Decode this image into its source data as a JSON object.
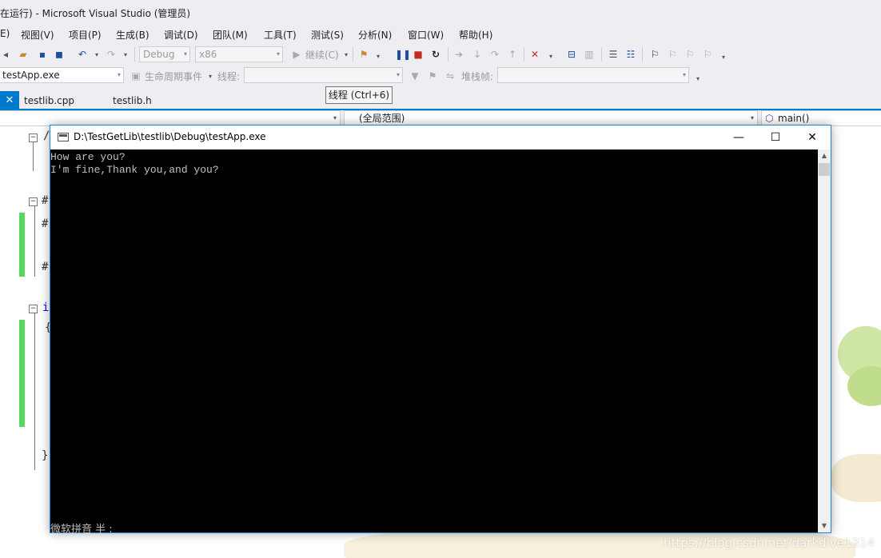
{
  "window": {
    "title": "在运行) - Microsoft Visual Studio (管理员)"
  },
  "menu": {
    "items": [
      "E)",
      "视图(V)",
      "项目(P)",
      "生成(B)",
      "调试(D)",
      "团队(M)",
      "工具(T)",
      "测试(S)",
      "分析(N)",
      "窗口(W)",
      "帮助(H)"
    ]
  },
  "toolbar": {
    "config": "Debug",
    "platform": "x86",
    "continue_label": "继续(C)",
    "process": "testApp.exe",
    "lifecycle_label": "生命周期事件",
    "thread_label": "线程:",
    "stackframe_label": "堆栈帧:"
  },
  "tabs": {
    "active": "testlib.cpp",
    "inactive": "testlib.h"
  },
  "tooltip": "线程 (Ctrl+6)",
  "navbar": {
    "scope": "(全局范围)",
    "member": "main()"
  },
  "console": {
    "title": "D:\\TestGetLib\\testlib\\Debug\\testApp.exe",
    "lines": [
      "How are you?",
      "I'm fine,Thank you,and you?"
    ],
    "ime_status": "微软拼音 半 :"
  },
  "watermark": "https://blog.csdn.net/darkdive1314",
  "colors": {
    "accent": "#007acc",
    "console_bg": "#000000",
    "console_text": "#c0c0c0",
    "change_bar": "#57d95f"
  }
}
